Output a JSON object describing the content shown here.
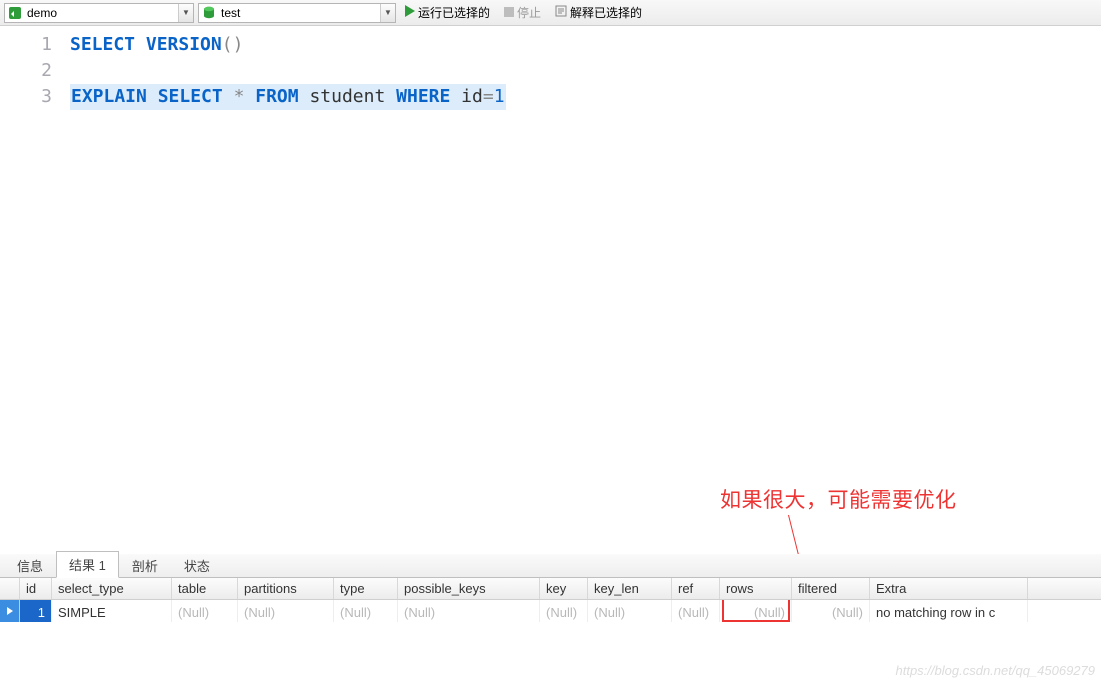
{
  "toolbar": {
    "connection": "demo",
    "database": "test",
    "run_label": "运行已选择的",
    "stop_label": "停止",
    "explain_label": "解释已选择的"
  },
  "editor": {
    "lines": [
      "1",
      "2",
      "3"
    ],
    "line1_select": "SELECT",
    "line1_version": "VERSION",
    "line1_parens": "()",
    "line3_explain": "EXPLAIN",
    "line3_select": "SELECT",
    "line3_star": " * ",
    "line3_from": "FROM",
    "line3_student": " student ",
    "line3_where": "WHERE",
    "line3_id": " id",
    "line3_eq": "=",
    "line3_val": "1"
  },
  "annotation": {
    "text": "如果很大，可能需要优化"
  },
  "tabs": {
    "info": "信息",
    "result1": "结果 1",
    "profile": "剖析",
    "status": "状态"
  },
  "grid": {
    "headers": {
      "id": "id",
      "select_type": "select_type",
      "table": "table",
      "partitions": "partitions",
      "type": "type",
      "possible_keys": "possible_keys",
      "key": "key",
      "key_len": "key_len",
      "ref": "ref",
      "rows": "rows",
      "filtered": "filtered",
      "extra": "Extra"
    },
    "row": {
      "id": "1",
      "select_type": "SIMPLE",
      "table": "(Null)",
      "partitions": "(Null)",
      "type": "(Null)",
      "possible_keys": "(Null)",
      "key": "(Null)",
      "key_len": "(Null)",
      "ref": "(Null)",
      "rows": "(Null)",
      "filtered": "(Null)",
      "extra": "no matching row in c"
    },
    "null_text": "(Null)"
  },
  "watermark": "https://blog.csdn.net/qq_45069279"
}
